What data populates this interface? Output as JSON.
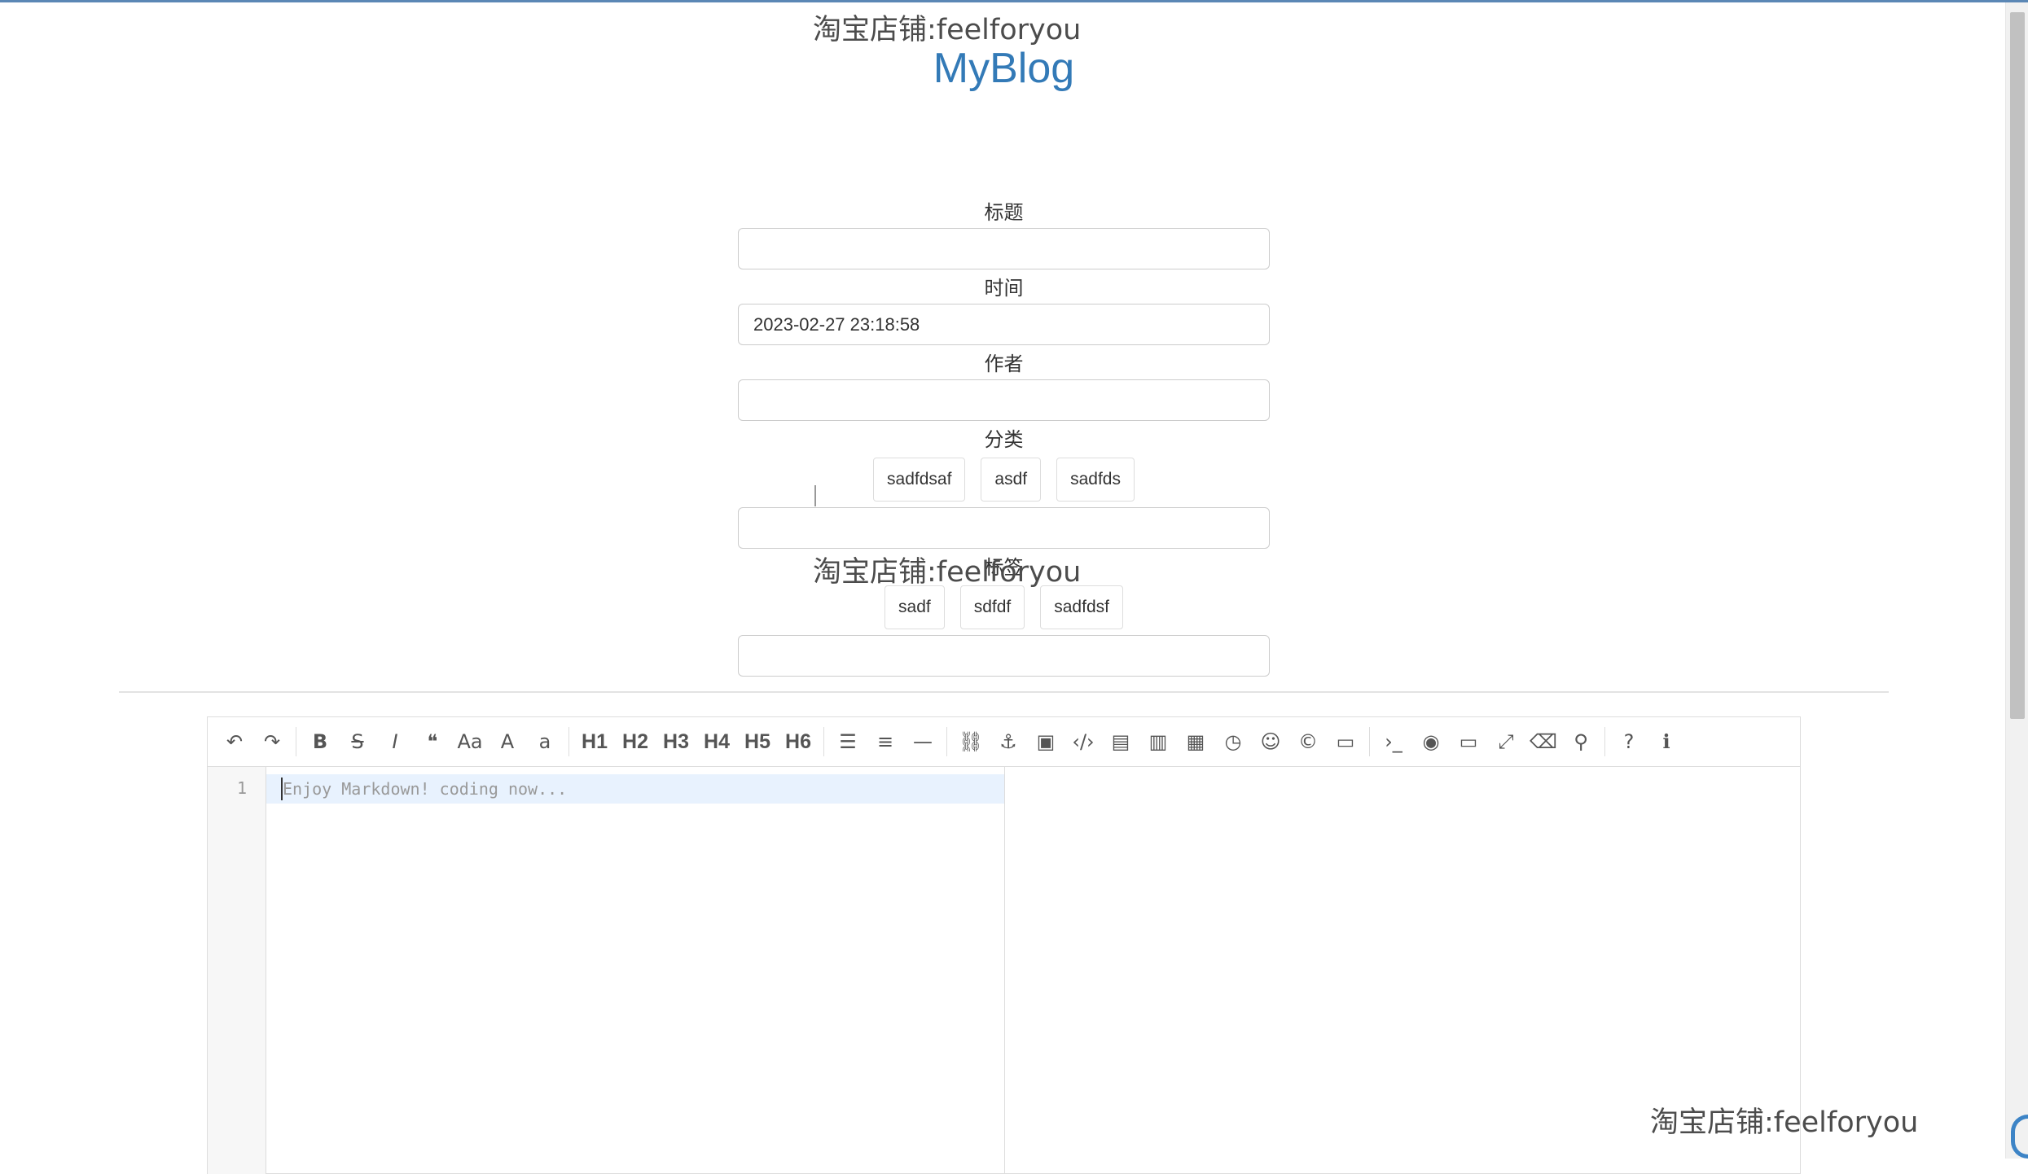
{
  "watermark": {
    "text": "淘宝店铺:feelforyou"
  },
  "brand": {
    "title": "MyBlog"
  },
  "form": {
    "title_label": "标题",
    "title_value": "",
    "time_label": "时间",
    "time_value": "2023-02-27 23:18:58",
    "author_label": "作者",
    "author_value": "",
    "category_label": "分类",
    "categories": [
      "sadfdsaf",
      "asdf",
      "sadfds"
    ],
    "category_value": "",
    "tag_label": "标签",
    "tags": [
      "sadf",
      "sdfdf",
      "sadfdsf"
    ],
    "tag_value": ""
  },
  "editor": {
    "line_number": "1",
    "placeholder": "Enjoy Markdown! coding now...",
    "toolbar": {
      "headings": [
        "H1",
        "H2",
        "H3",
        "H4",
        "H5",
        "H6"
      ],
      "icons": [
        "undo-icon",
        "redo-icon",
        "bold-icon",
        "strikethrough-icon",
        "italic-icon",
        "quote-icon",
        "uppercase-icon",
        "ucwords-icon",
        "lowercase-icon",
        "list-ul-icon",
        "list-ol-icon",
        "hr-icon",
        "link-icon",
        "anchor-icon",
        "image-icon",
        "code-icon",
        "preformatted-text-icon",
        "code-block-icon",
        "table-icon",
        "datetime-icon",
        "emoji-icon",
        "html-entities-icon",
        "pagebreak-icon",
        "goto-line-icon",
        "watch-icon",
        "preview-icon",
        "fullscreen-icon",
        "clear-icon",
        "search-icon",
        "help-icon",
        "info-icon"
      ]
    }
  }
}
